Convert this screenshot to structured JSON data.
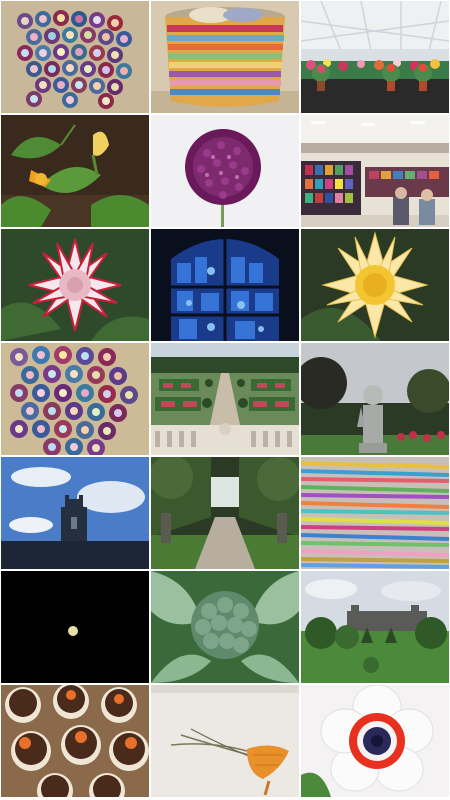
{
  "photos": [
    {
      "subject": "crochet-hexagon-motifs"
    },
    {
      "subject": "striped-crochet-basket"
    },
    {
      "subject": "flower-show-marquee"
    },
    {
      "subject": "courgette-flower"
    },
    {
      "subject": "purple-allium"
    },
    {
      "subject": "yarn-hall"
    },
    {
      "subject": "red-white-dahlia"
    },
    {
      "subject": "blue-stained-glass"
    },
    {
      "subject": "yellow-dahlia"
    },
    {
      "subject": "crochet-hexagon-blanket"
    },
    {
      "subject": "formal-garden-terrace"
    },
    {
      "subject": "garden-statue"
    },
    {
      "subject": "church-tower-sky"
    },
    {
      "subject": "tree-lined-avenue"
    },
    {
      "subject": "colourful-sticks"
    },
    {
      "subject": "moon-night-sky"
    },
    {
      "subject": "broccoli-plant"
    },
    {
      "subject": "stately-home-park"
    },
    {
      "subject": "chocolate-cupcakes"
    },
    {
      "subject": "carrot-on-hook"
    },
    {
      "subject": "red-anemone"
    }
  ]
}
